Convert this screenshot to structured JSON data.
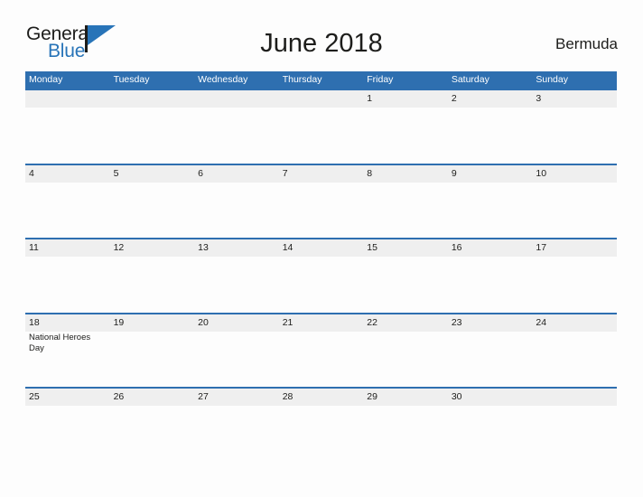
{
  "brand": {
    "name_part1": "General",
    "name_part2": "Blue"
  },
  "header": {
    "title": "June 2018",
    "locale": "Bermuda"
  },
  "colors": {
    "header_blue": "#2e6fb0",
    "band_gray": "#efefef",
    "text_dark": "#1d1d1b",
    "logo_blue": "#2874b8",
    "page_background": "#fdfdfd"
  },
  "calendar": {
    "weekdays": [
      "Monday",
      "Tuesday",
      "Wednesday",
      "Thursday",
      "Friday",
      "Saturday",
      "Sunday"
    ],
    "weeks": [
      [
        {
          "date": "",
          "event": ""
        },
        {
          "date": "",
          "event": ""
        },
        {
          "date": "",
          "event": ""
        },
        {
          "date": "",
          "event": ""
        },
        {
          "date": "1",
          "event": ""
        },
        {
          "date": "2",
          "event": ""
        },
        {
          "date": "3",
          "event": ""
        }
      ],
      [
        {
          "date": "4",
          "event": ""
        },
        {
          "date": "5",
          "event": ""
        },
        {
          "date": "6",
          "event": ""
        },
        {
          "date": "7",
          "event": ""
        },
        {
          "date": "8",
          "event": ""
        },
        {
          "date": "9",
          "event": ""
        },
        {
          "date": "10",
          "event": ""
        }
      ],
      [
        {
          "date": "11",
          "event": ""
        },
        {
          "date": "12",
          "event": ""
        },
        {
          "date": "13",
          "event": ""
        },
        {
          "date": "14",
          "event": ""
        },
        {
          "date": "15",
          "event": ""
        },
        {
          "date": "16",
          "event": ""
        },
        {
          "date": "17",
          "event": ""
        }
      ],
      [
        {
          "date": "18",
          "event": "National Heroes Day"
        },
        {
          "date": "19",
          "event": ""
        },
        {
          "date": "20",
          "event": ""
        },
        {
          "date": "21",
          "event": ""
        },
        {
          "date": "22",
          "event": ""
        },
        {
          "date": "23",
          "event": ""
        },
        {
          "date": "24",
          "event": ""
        }
      ],
      [
        {
          "date": "25",
          "event": ""
        },
        {
          "date": "26",
          "event": ""
        },
        {
          "date": "27",
          "event": ""
        },
        {
          "date": "28",
          "event": ""
        },
        {
          "date": "29",
          "event": ""
        },
        {
          "date": "30",
          "event": ""
        },
        {
          "date": "",
          "event": ""
        }
      ]
    ]
  }
}
